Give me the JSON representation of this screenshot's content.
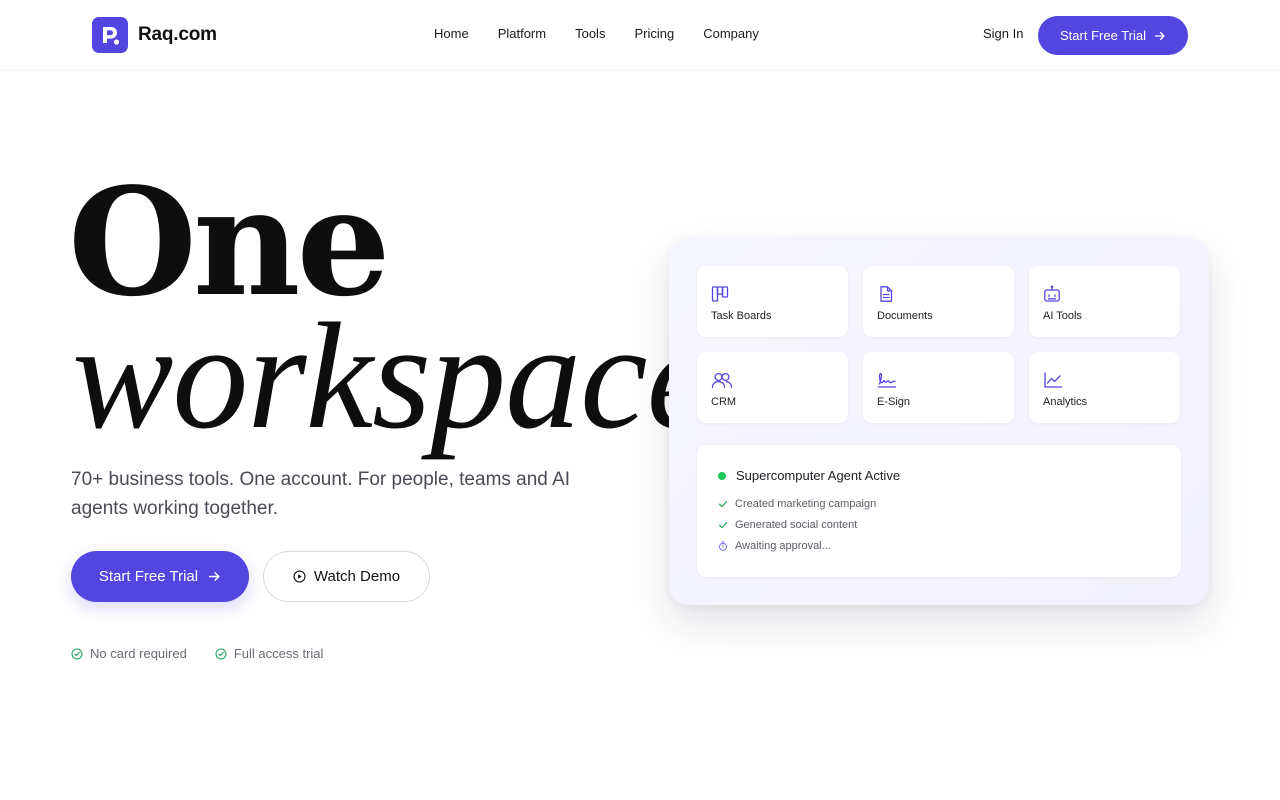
{
  "brand": {
    "name": "Raq.com",
    "accent": "#5346e0"
  },
  "nav": {
    "links": [
      "Home",
      "Platform",
      "Tools",
      "Pricing",
      "Company"
    ],
    "sign_in": "Sign In",
    "cta": "Start Free Trial"
  },
  "hero": {
    "headline_1": "One",
    "headline_2": "workspace",
    "subtitle": "70+ business tools. One account. For people, teams and AI agents working together.",
    "primary_cta": "Start Free Trial",
    "secondary_cta": "Watch Demo",
    "perks": [
      "No card required",
      "Full access trial"
    ]
  },
  "card": {
    "tiles": [
      {
        "label": "Task Boards",
        "icon": "grid-board-icon"
      },
      {
        "label": "Documents",
        "icon": "document-icon"
      },
      {
        "label": "AI Tools",
        "icon": "robot-icon"
      },
      {
        "label": "CRM",
        "icon": "users-icon"
      },
      {
        "label": "E-Sign",
        "icon": "signature-icon"
      },
      {
        "label": "Analytics",
        "icon": "line-chart-icon"
      }
    ],
    "agent": {
      "title": "Supercomputer Agent Active",
      "status_color": "#22c55e",
      "items": [
        {
          "text": "Created marketing campaign",
          "state": "done"
        },
        {
          "text": "Generated social content",
          "state": "done"
        },
        {
          "text": "Awaiting approval...",
          "state": "pending"
        }
      ]
    }
  }
}
